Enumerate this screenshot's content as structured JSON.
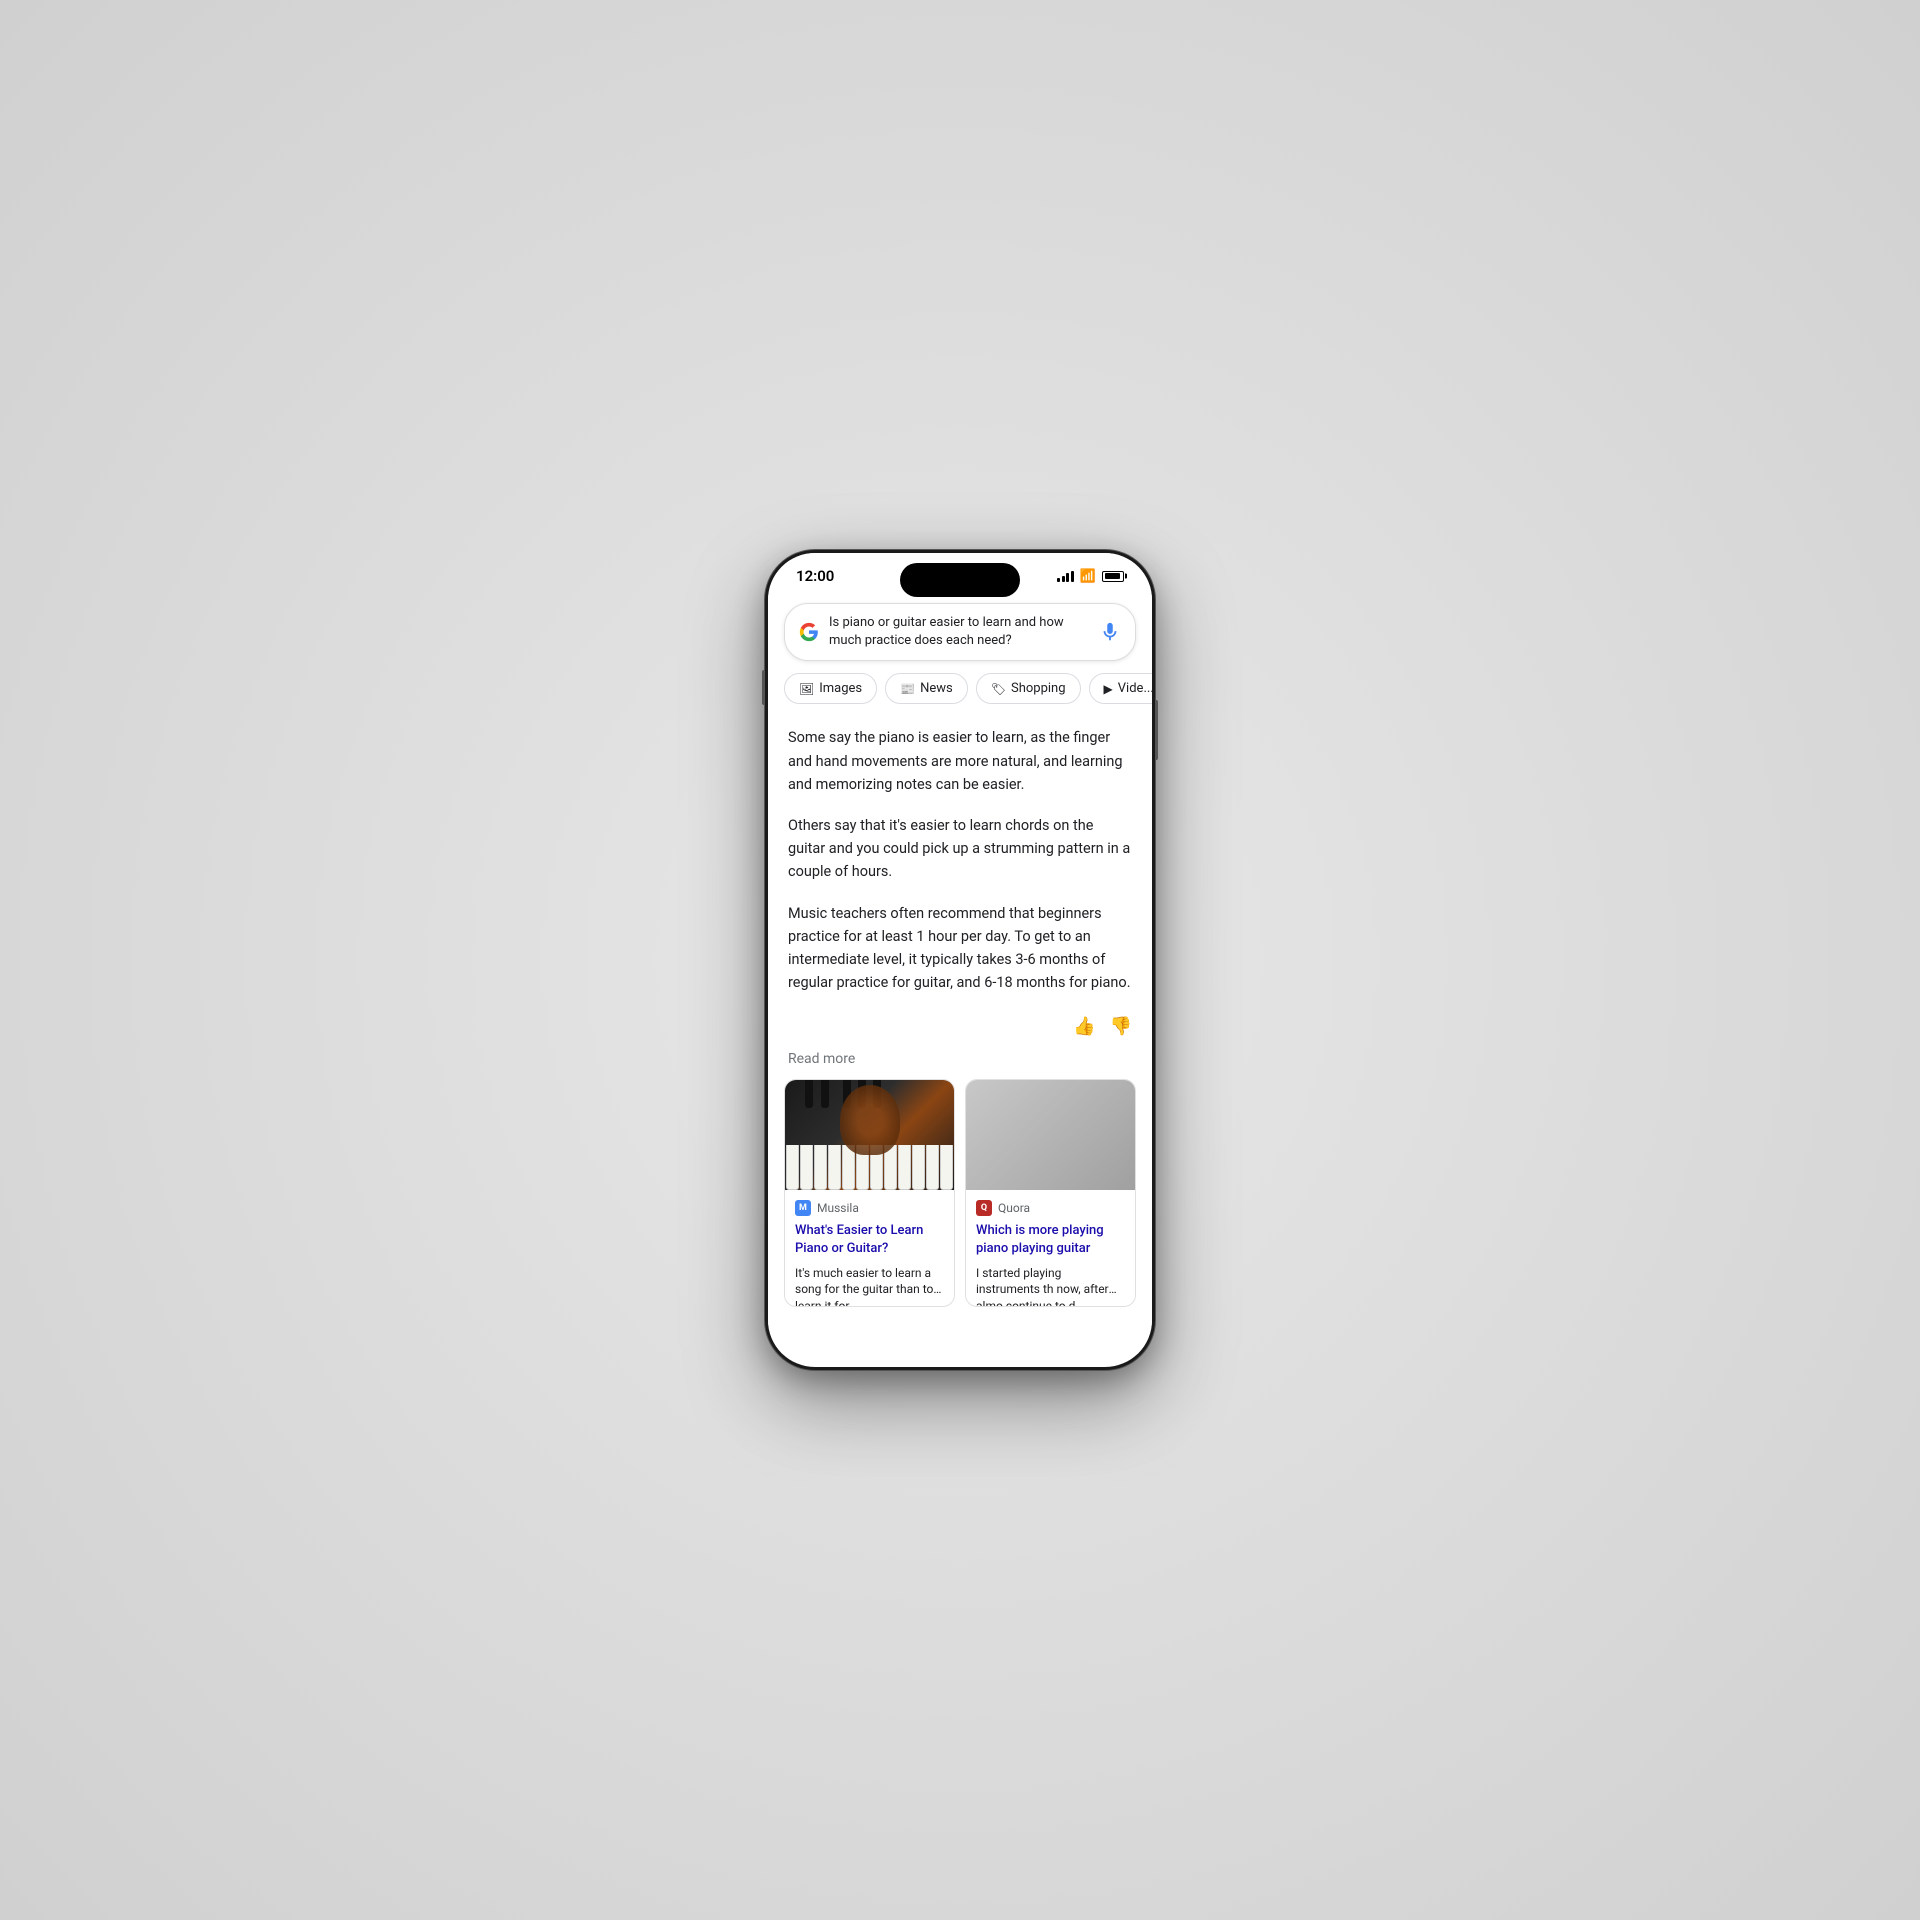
{
  "scene": {
    "background": "#e0e0e0"
  },
  "phone": {
    "status": {
      "time": "12:00"
    },
    "search": {
      "query": "Is piano or guitar easier to learn and how much practice does each need?"
    },
    "filter_tabs": [
      {
        "label": "Images",
        "icon": "🖼"
      },
      {
        "label": "News",
        "icon": "📰"
      },
      {
        "label": "Shopping",
        "icon": "🏷"
      },
      {
        "label": "Vide...",
        "icon": "▶"
      }
    ],
    "answer": {
      "paragraph1": "Some say the piano is easier to learn, as the finger and hand movements are more natural, and learning and memorizing notes can be easier.",
      "paragraph2": "Others say that it's easier to learn chords on the guitar and you could pick up a strumming pattern in a couple of hours.",
      "paragraph3": "Music teachers often recommend that beginners practice for at least 1 hour per day. To get to an intermediate level, it typically takes 3-6 months of regular practice for guitar, and 6-18 months for piano.",
      "read_more": "Read more"
    },
    "cards": [
      {
        "source": "Mussila",
        "source_logo": "M",
        "title": "What's Easier to Learn Piano or Guitar?",
        "snippet": "It's much easier to learn a song for the guitar than to learn it for"
      },
      {
        "source": "Quora",
        "source_logo": "Q",
        "title": "Which is more playing piano playing guitar",
        "snippet": "I started playing instruments th now, after almo continue to d proficient o"
      }
    ]
  }
}
